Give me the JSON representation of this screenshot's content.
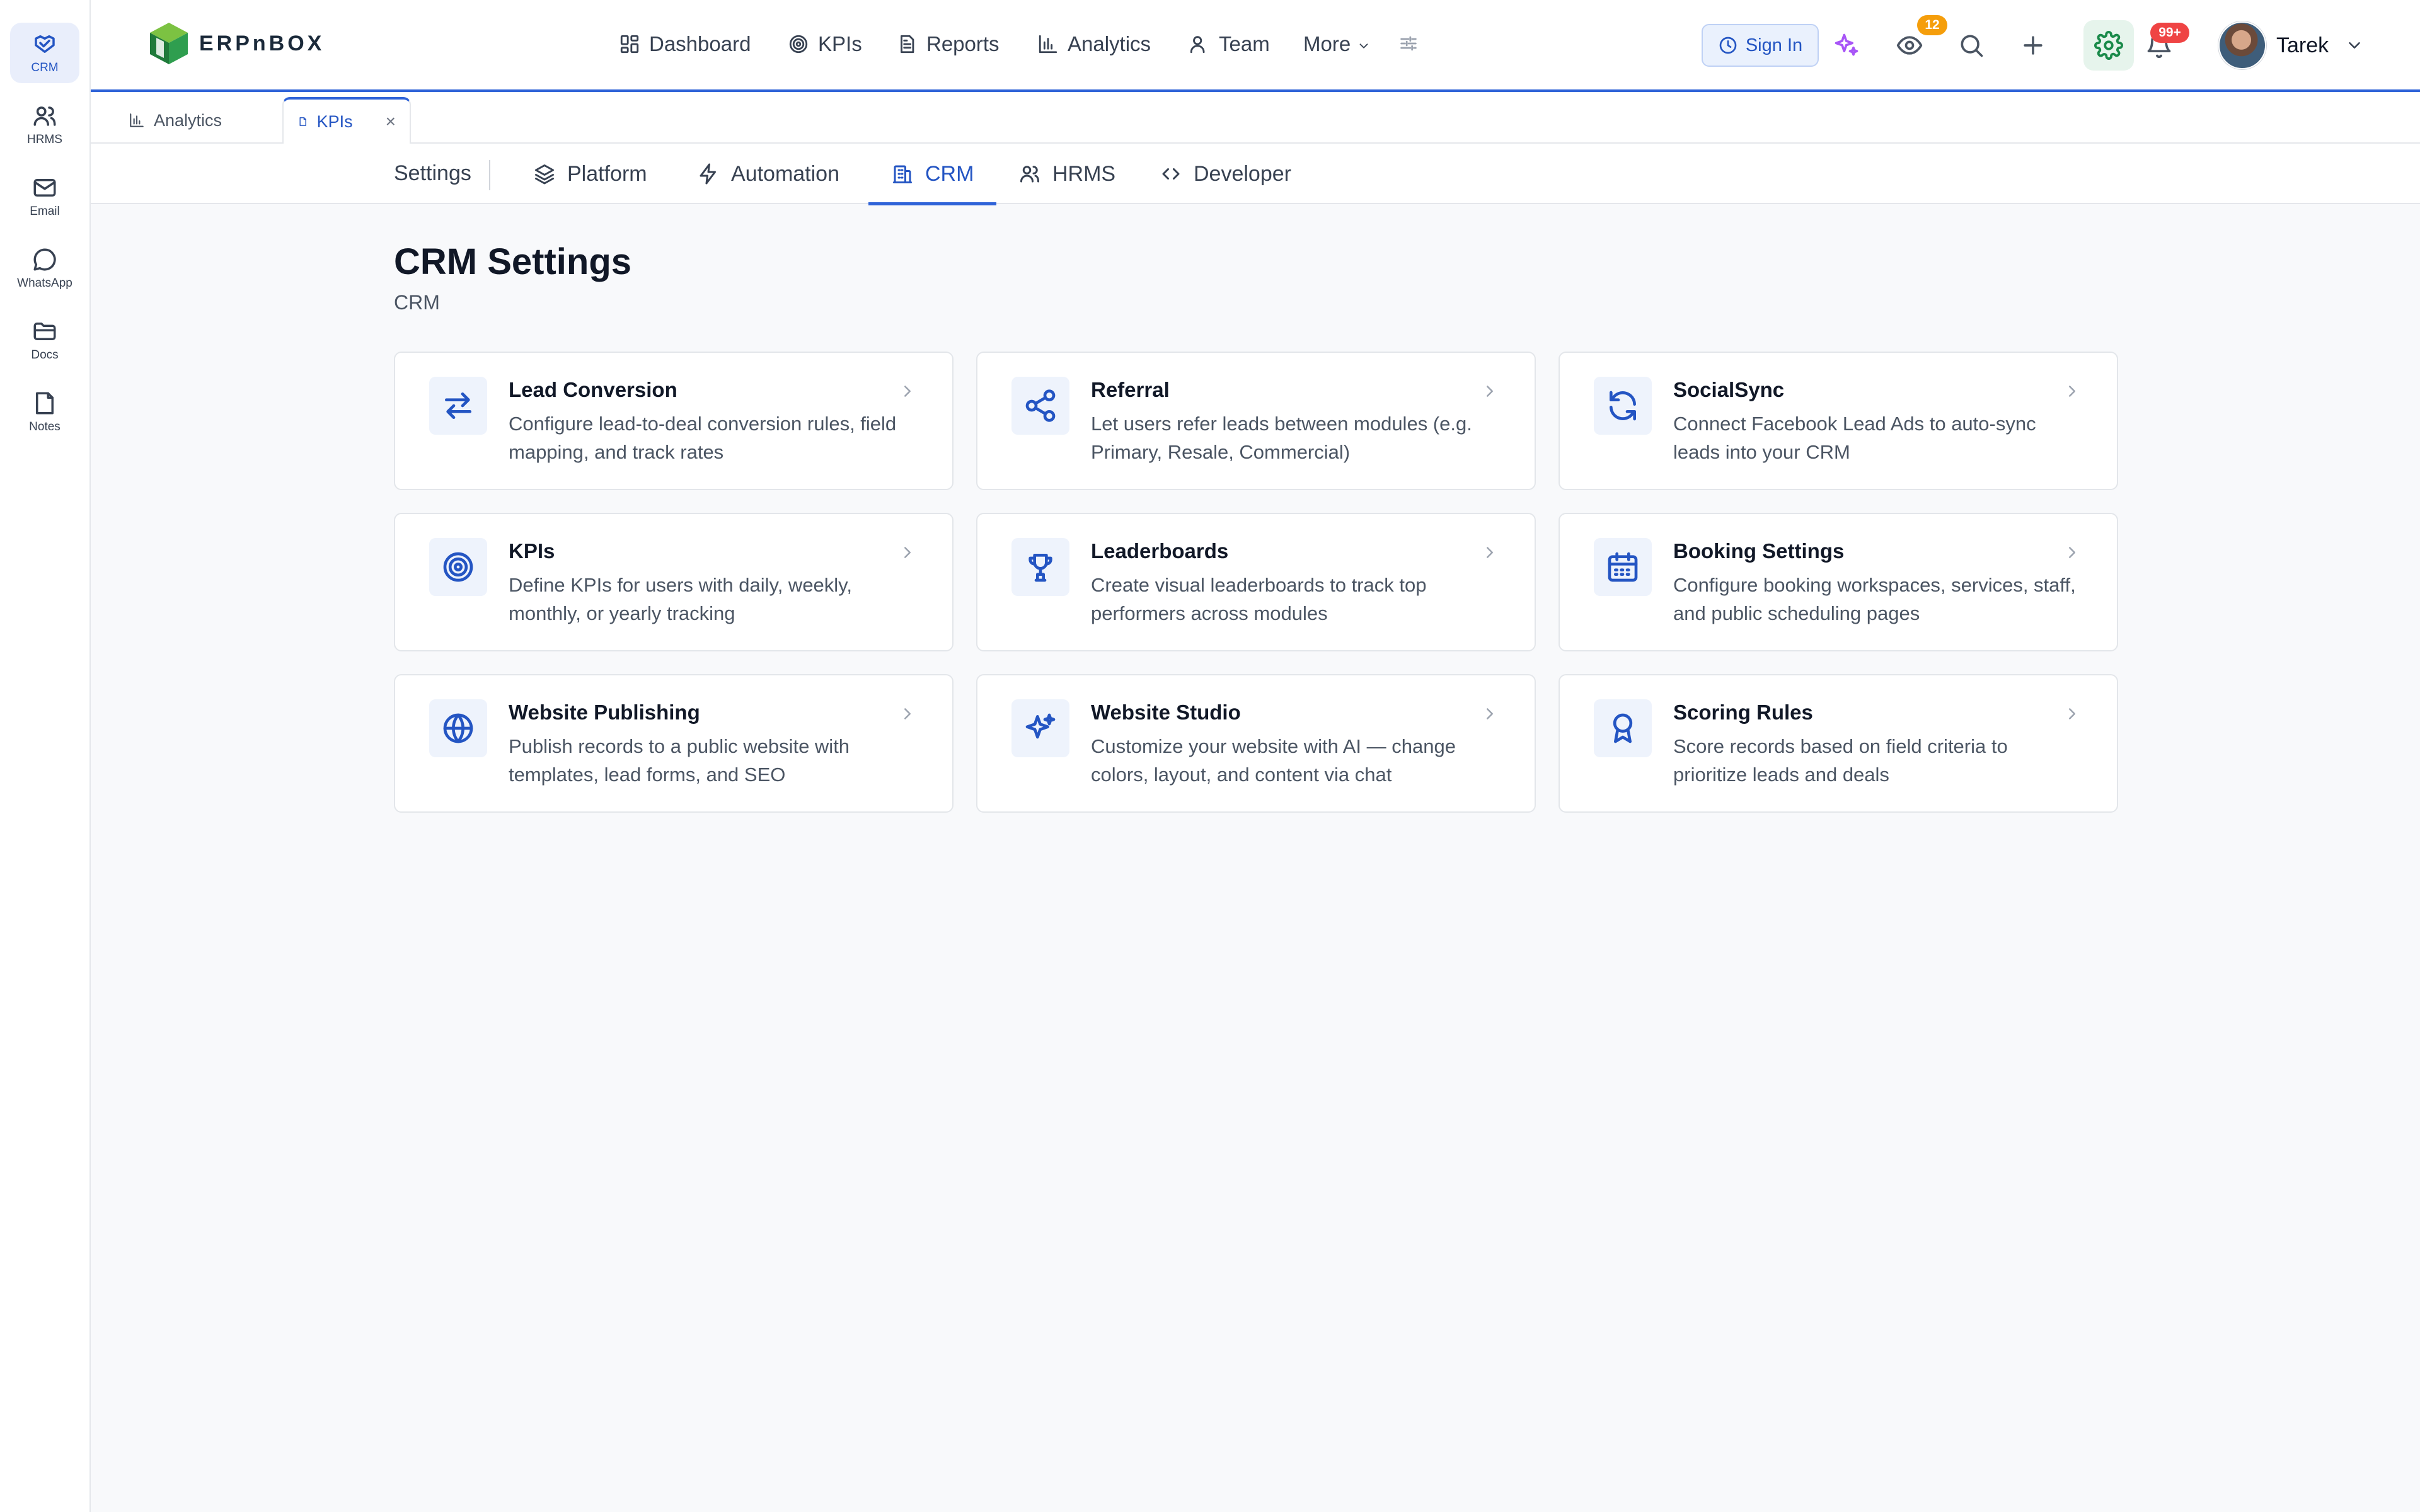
{
  "rail": {
    "items": [
      {
        "label": "CRM",
        "icon": "handshake-icon",
        "active": true
      },
      {
        "label": "HRMS",
        "icon": "users-icon"
      },
      {
        "label": "Email",
        "icon": "mail-icon"
      },
      {
        "label": "WhatsApp",
        "icon": "chat-bubble-icon"
      },
      {
        "label": "Docs",
        "icon": "folder-icon"
      },
      {
        "label": "Notes",
        "icon": "note-icon"
      }
    ]
  },
  "header": {
    "logo_text": "ERPnBOX",
    "nav": [
      {
        "label": "Dashboard",
        "icon": "grid-icon"
      },
      {
        "label": "KPIs",
        "icon": "target-icon"
      },
      {
        "label": "Reports",
        "icon": "document-icon"
      },
      {
        "label": "Analytics",
        "icon": "bar-chart-icon"
      },
      {
        "label": "Team",
        "icon": "user-icon"
      },
      {
        "label": "More",
        "icon": "chevron-down-icon"
      }
    ],
    "sign_in_label": "Sign In",
    "watch_badge": "12",
    "notifications_badge": "99+",
    "user_name": "Tarek",
    "colors": {
      "accent": "#2f63d8",
      "watch_badge": "#f59e0b",
      "notify_badge": "#ef4444",
      "gear": "#1a8a4a",
      "sparkle": "#a855f7"
    }
  },
  "page_tabs": [
    {
      "label": "Analytics",
      "icon": "bar-chart-icon"
    },
    {
      "label": "KPIs",
      "icon": "document-icon",
      "active": true,
      "close": "×"
    }
  ],
  "settings_nav": {
    "label": "Settings",
    "tabs": [
      {
        "label": "Platform",
        "icon": "layers-icon"
      },
      {
        "label": "Automation",
        "icon": "bolt-icon"
      },
      {
        "label": "CRM",
        "icon": "building-icon",
        "active": true
      },
      {
        "label": "HRMS",
        "icon": "users-icon"
      },
      {
        "label": "Developer",
        "icon": "code-icon"
      }
    ]
  },
  "main": {
    "title": "CRM Settings",
    "subtitle": "CRM",
    "cards": [
      {
        "title": "Lead Conversion",
        "desc": "Configure lead-to-deal conversion rules, field mapping, and track rates",
        "icon": "arrows-swap-icon"
      },
      {
        "title": "Referral",
        "desc": "Let users refer leads between modules (e.g. Primary, Resale, Commercial)",
        "icon": "share-icon"
      },
      {
        "title": "SocialSync",
        "desc": "Connect Facebook Lead Ads to auto-sync leads into your CRM",
        "icon": "refresh-icon"
      },
      {
        "title": "KPIs",
        "desc": "Define KPIs for users with daily, weekly, monthly, or yearly tracking",
        "icon": "target-icon"
      },
      {
        "title": "Leaderboards",
        "desc": "Create visual leaderboards to track top performers across modules",
        "icon": "trophy-icon"
      },
      {
        "title": "Booking Settings",
        "desc": "Configure booking workspaces, services, staff, and public scheduling pages",
        "icon": "calendar-icon"
      },
      {
        "title": "Website Publishing",
        "desc": "Publish records to a public website with templates, lead forms, and SEO",
        "icon": "globe-icon"
      },
      {
        "title": "Website Studio",
        "desc": "Customize your website with AI — change colors, layout, and content via chat",
        "icon": "sparkles-icon"
      },
      {
        "title": "Scoring Rules",
        "desc": "Score records based on field criteria to prioritize leads and deals",
        "icon": "award-icon"
      }
    ]
  }
}
